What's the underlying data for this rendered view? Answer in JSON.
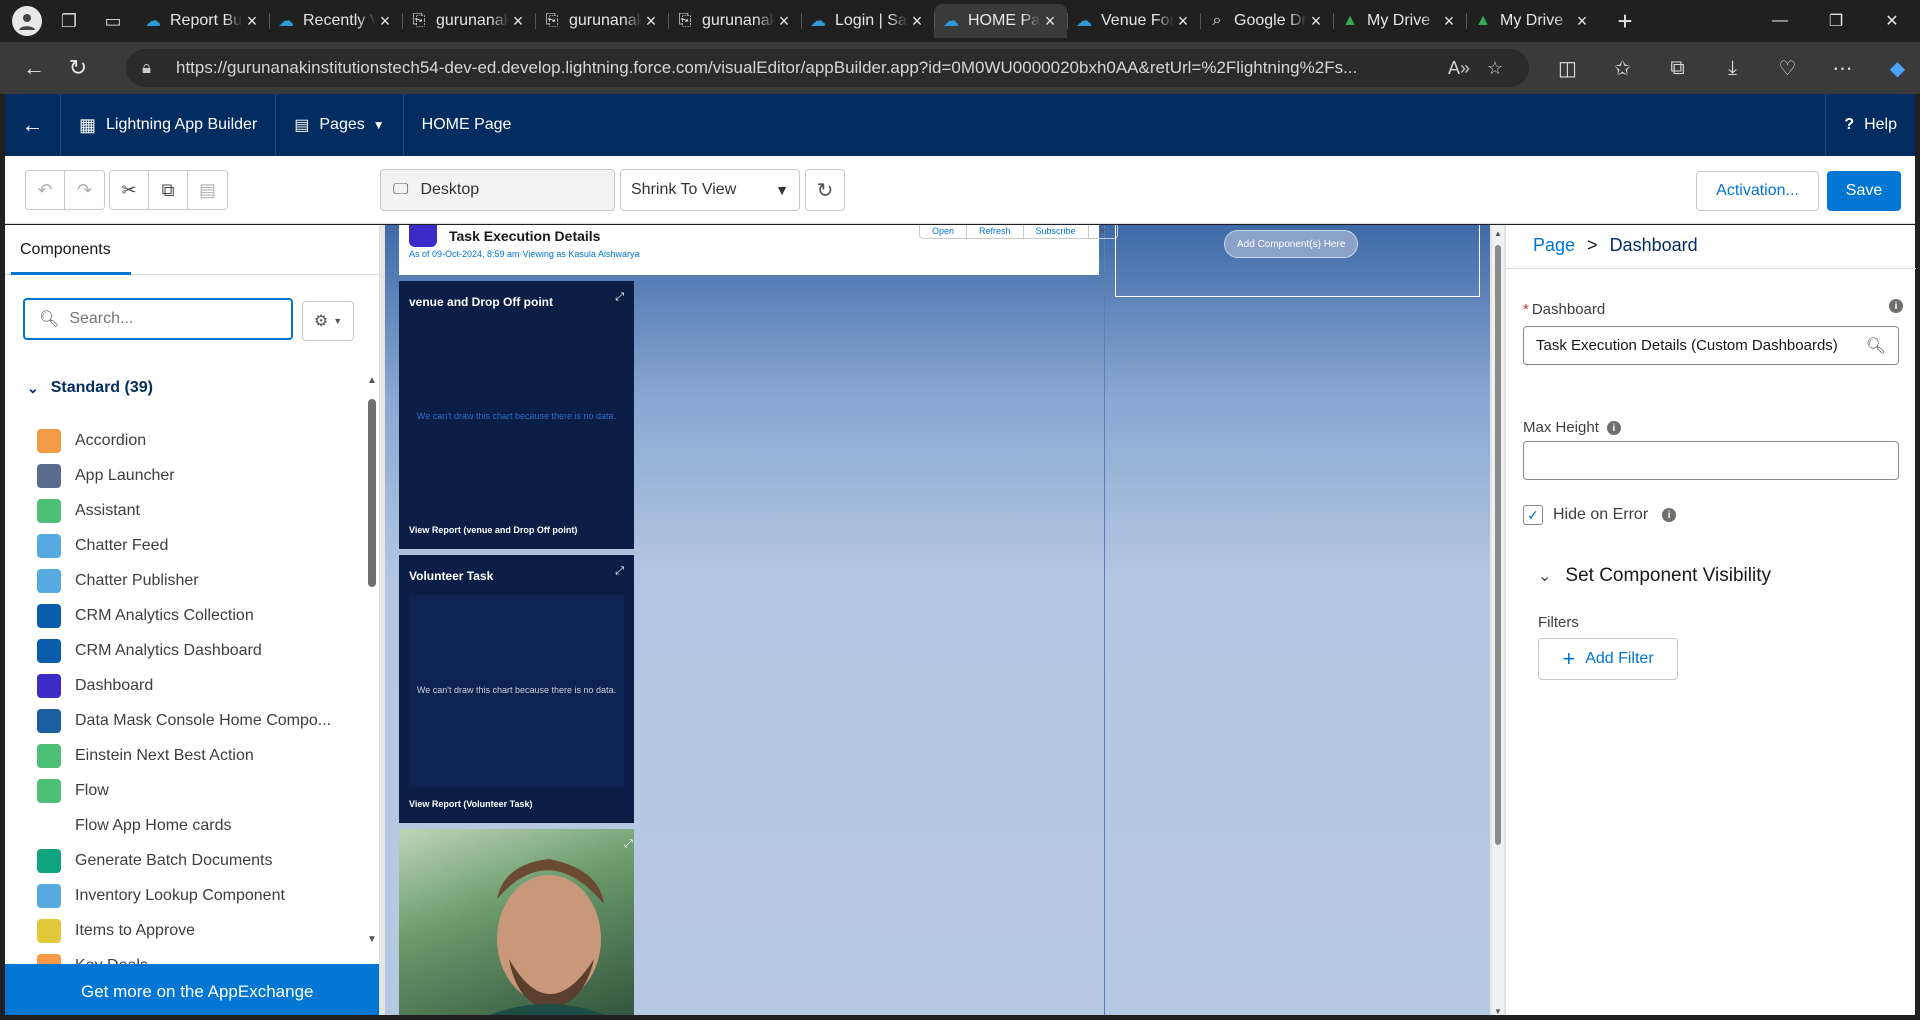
{
  "browser": {
    "tabs": [
      {
        "title": "Report Builder",
        "favicon": "salesforce-cloud-icon",
        "active": false
      },
      {
        "title": "Recently Viewed",
        "favicon": "salesforce-cloud-icon",
        "active": false
      },
      {
        "title": "gurunanak",
        "favicon": "document-icon",
        "active": false
      },
      {
        "title": "gurunanak",
        "favicon": "document-icon",
        "active": false
      },
      {
        "title": "gurunanak",
        "favicon": "document-icon",
        "active": false
      },
      {
        "title": "Login | Salesforce",
        "favicon": "salesforce-cloud-icon",
        "active": false
      },
      {
        "title": "HOME Page",
        "favicon": "salesforce-cloud-icon",
        "active": true
      },
      {
        "title": "Venue Form",
        "favicon": "salesforce-cloud-icon",
        "active": false
      },
      {
        "title": "Google Drive",
        "favicon": "google-search-icon",
        "active": false
      },
      {
        "title": "My Drive",
        "favicon": "google-drive-icon",
        "active": false
      },
      {
        "title": "My Drive",
        "favicon": "google-drive-icon",
        "active": false
      }
    ],
    "url": "https://gurunanakinstitutionstech54-dev-ed.develop.lightning.force.com/visualEditor/appBuilder.app?id=0M0WU0000020bxh0AA&retUrl=%2Flightning%2Fs..."
  },
  "header": {
    "app_name": "Lightning App Builder",
    "pages_label": "Pages",
    "page_name": "HOME Page",
    "help_label": "Help"
  },
  "toolbar": {
    "device": "Desktop",
    "view_mode": "Shrink To View",
    "activation_label": "Activation...",
    "save_label": "Save"
  },
  "left_panel": {
    "tab_label": "Components",
    "search_placeholder": "Search...",
    "section_title": "Standard (39)",
    "components": [
      {
        "label": "Accordion",
        "icon": "accordion-icon",
        "color": "#f59a47"
      },
      {
        "label": "App Launcher",
        "icon": "app-launcher-icon",
        "color": "#5a6b8c"
      },
      {
        "label": "Assistant",
        "icon": "assistant-icon",
        "color": "#4bc076"
      },
      {
        "label": "Chatter Feed",
        "icon": "chatter-icon",
        "color": "#56aadf"
      },
      {
        "label": "Chatter Publisher",
        "icon": "lightning-bolt-icon",
        "color": "#56aadf"
      },
      {
        "label": "CRM Analytics Collection",
        "icon": "analytics-icon",
        "color": "#0b5cab"
      },
      {
        "label": "CRM Analytics Dashboard",
        "icon": "analytics-icon",
        "color": "#0b5cab"
      },
      {
        "label": "Dashboard",
        "icon": "dashboard-icon",
        "color": "#3b2cc7"
      },
      {
        "label": "Data Mask Console Home Compo...",
        "icon": "lightning-bolt-icon",
        "color": "#1b5f9e"
      },
      {
        "label": "Einstein Next Best Action",
        "icon": "einstein-icon",
        "color": "#4bc076"
      },
      {
        "label": "Flow",
        "icon": "flow-icon",
        "color": "#4bc076"
      },
      {
        "label": "Flow App Home cards",
        "icon": "",
        "color": ""
      },
      {
        "label": "Generate Batch Documents",
        "icon": "batch-docs-icon",
        "color": "#0fa37f"
      },
      {
        "label": "Inventory Lookup Component",
        "icon": "cube-icon",
        "color": "#56aadf"
      },
      {
        "label": "Items to Approve",
        "icon": "approval-icon",
        "color": "#e2c93b"
      },
      {
        "label": "Key Deals",
        "icon": "deals-icon",
        "color": "#f59a47"
      }
    ],
    "appexchange_label": "Get more on the AppExchange"
  },
  "canvas": {
    "dashboard_title": "Task Execution Details",
    "dashboard_subtitle": "As of 09-Oct-2024, 8:59 am·Viewing as Kasula Aishwarya",
    "dashboard_buttons": [
      "Open",
      "Refresh",
      "Subscribe",
      "▾"
    ],
    "cards": [
      {
        "title": "venue and Drop Off point",
        "nodata": "We can't draw this chart because there is no data.",
        "link": "View Report (venue and Drop Off point)"
      },
      {
        "title": "Volunteer Task",
        "nodata": "We can't draw this chart because there is no data.",
        "link": "View Report (Volunteer Task)"
      }
    ],
    "add_component_label": "Add Component(s) Here"
  },
  "properties": {
    "breadcrumb_root": "Page",
    "breadcrumb_sep": ">",
    "breadcrumb_current": "Dashboard",
    "dashboard_label": "Dashboard",
    "dashboard_value": "Task Execution Details (Custom Dashboards)",
    "max_height_label": "Max Height",
    "max_height_value": "",
    "hide_on_error_label": "Hide on Error",
    "hide_on_error_checked": true,
    "visibility_title": "Set Component Visibility",
    "filters_label": "Filters",
    "add_filter_label": "Add Filter"
  },
  "colors": {
    "salesforce_navy": "#032d60",
    "brand_blue": "#0176d3",
    "card_navy": "#0b1e45"
  }
}
